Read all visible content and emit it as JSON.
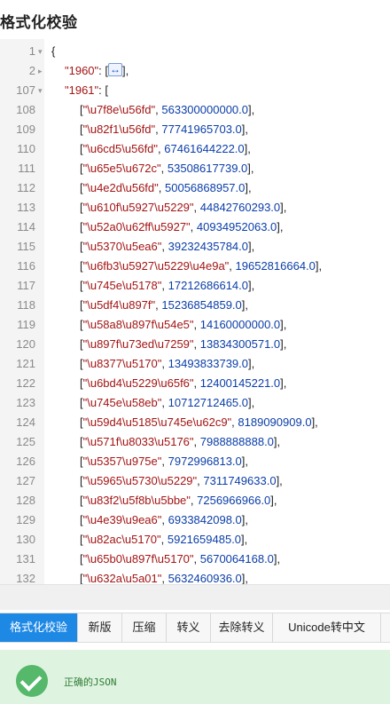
{
  "header": {
    "title": "格式化校验"
  },
  "editor": {
    "lines": [
      {
        "n": "1",
        "fold": "▾",
        "kind": "open",
        "text": "{"
      },
      {
        "n": "2",
        "fold": "▸",
        "kind": "collapsed",
        "key": "\"1960\"",
        "sep": ": [",
        "close": "],",
        "icon": "expand-icon"
      },
      {
        "n": "107",
        "fold": "▾",
        "kind": "keyopen",
        "key": "\"1961\"",
        "sep": ": ["
      },
      {
        "n": "108",
        "kind": "row",
        "str": "\"\\u7f8e\\u56fd\"",
        "num": "563300000000.0"
      },
      {
        "n": "109",
        "kind": "row",
        "str": "\"\\u82f1\\u56fd\"",
        "num": "77741965703.0"
      },
      {
        "n": "110",
        "kind": "row",
        "str": "\"\\u6cd5\\u56fd\"",
        "num": "67461644222.0"
      },
      {
        "n": "111",
        "kind": "row",
        "str": "\"\\u65e5\\u672c\"",
        "num": "53508617739.0"
      },
      {
        "n": "112",
        "kind": "row",
        "str": "\"\\u4e2d\\u56fd\"",
        "num": "50056868957.0"
      },
      {
        "n": "113",
        "kind": "row",
        "str": "\"\\u610f\\u5927\\u5229\"",
        "num": "44842760293.0"
      },
      {
        "n": "114",
        "kind": "row",
        "str": "\"\\u52a0\\u62ff\\u5927\"",
        "num": "40934952063.0"
      },
      {
        "n": "115",
        "kind": "row",
        "str": "\"\\u5370\\u5ea6\"",
        "num": "39232435784.0"
      },
      {
        "n": "116",
        "kind": "row",
        "str": "\"\\u6fb3\\u5927\\u5229\\u4e9a\"",
        "num": "19652816664.0"
      },
      {
        "n": "117",
        "kind": "row",
        "str": "\"\\u745e\\u5178\"",
        "num": "17212686614.0"
      },
      {
        "n": "118",
        "kind": "row",
        "str": "\"\\u5df4\\u897f\"",
        "num": "15236854859.0"
      },
      {
        "n": "119",
        "kind": "row",
        "str": "\"\\u58a8\\u897f\\u54e5\"",
        "num": "14160000000.0"
      },
      {
        "n": "120",
        "kind": "row",
        "str": "\"\\u897f\\u73ed\\u7259\"",
        "num": "13834300571.0"
      },
      {
        "n": "121",
        "kind": "row",
        "str": "\"\\u8377\\u5170\"",
        "num": "13493833739.0"
      },
      {
        "n": "122",
        "kind": "row",
        "str": "\"\\u6bd4\\u5229\\u65f6\"",
        "num": "12400145221.0"
      },
      {
        "n": "123",
        "kind": "row",
        "str": "\"\\u745e\\u58eb\"",
        "num": "10712712465.0"
      },
      {
        "n": "124",
        "kind": "row",
        "str": "\"\\u59d4\\u5185\\u745e\\u62c9\"",
        "num": "8189090909.0"
      },
      {
        "n": "125",
        "kind": "row",
        "str": "\"\\u571f\\u8033\\u5176\"",
        "num": "7988888888.0"
      },
      {
        "n": "126",
        "kind": "row",
        "str": "\"\\u5357\\u975e\"",
        "num": "7972996813.0"
      },
      {
        "n": "127",
        "kind": "row",
        "str": "\"\\u5965\\u5730\\u5229\"",
        "num": "7311749633.0"
      },
      {
        "n": "128",
        "kind": "row",
        "str": "\"\\u83f2\\u5f8b\\u5bbe\"",
        "num": "7256966966.0"
      },
      {
        "n": "129",
        "kind": "row",
        "str": "\"\\u4e39\\u9ea6\"",
        "num": "6933842098.0"
      },
      {
        "n": "130",
        "kind": "row",
        "str": "\"\\u82ac\\u5170\"",
        "num": "5921659485.0"
      },
      {
        "n": "131",
        "kind": "row",
        "str": "\"\\u65b0\\u897f\\u5170\"",
        "num": "5670064168.0"
      },
      {
        "n": "132",
        "kind": "row",
        "str": "\"\\u632a\\u5a01\"",
        "num": "5632460936.0"
      }
    ]
  },
  "toolbar": {
    "buttons": [
      {
        "label": "格式化校验",
        "active": true,
        "name": "format-validate-button"
      },
      {
        "label": "新版",
        "active": false,
        "name": "new-version-button"
      },
      {
        "label": "压缩",
        "active": false,
        "name": "compress-button"
      },
      {
        "label": "转义",
        "active": false,
        "name": "escape-button"
      },
      {
        "label": "去除转义",
        "active": false,
        "name": "unescape-button"
      },
      {
        "label": "Unicode转中文",
        "active": false,
        "name": "unicode-to-chinese-button"
      }
    ]
  },
  "status": {
    "message": "正确的JSON",
    "icon": "check-circle-icon",
    "color": "#55b86a"
  }
}
